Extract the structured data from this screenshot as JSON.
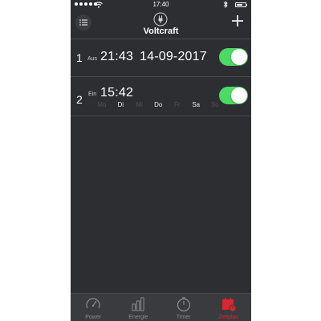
{
  "status_bar": {
    "time": "17:40"
  },
  "header": {
    "title": "Voltcraft"
  },
  "rows": [
    {
      "number": "1",
      "state": "Aus",
      "time": "21:43",
      "date": "14-09-2017",
      "enabled": true
    },
    {
      "number": "2",
      "state": "Ein",
      "time": "15:42",
      "enabled": true,
      "days": [
        {
          "label": "Mo",
          "active": false
        },
        {
          "label": "Di",
          "active": true
        },
        {
          "label": "Mi",
          "active": false
        },
        {
          "label": "Do",
          "active": true
        },
        {
          "label": "Fr",
          "active": false
        },
        {
          "label": "Sa",
          "active": true
        },
        {
          "label": "So",
          "active": false
        }
      ]
    }
  ],
  "tabs": [
    {
      "label": "Power",
      "icon": "gauge-icon",
      "active": false
    },
    {
      "label": "Energie",
      "icon": "bar-chart-icon",
      "active": false
    },
    {
      "label": "Timer",
      "icon": "stopwatch-icon",
      "active": false
    },
    {
      "label": "Zeitplan",
      "icon": "calendar-icon",
      "active": true
    }
  ],
  "colors": {
    "background": "#2d2e32",
    "toggle_on": "#4cd964",
    "accent": "#d9262f",
    "tab_inactive": "#8b8c91"
  }
}
